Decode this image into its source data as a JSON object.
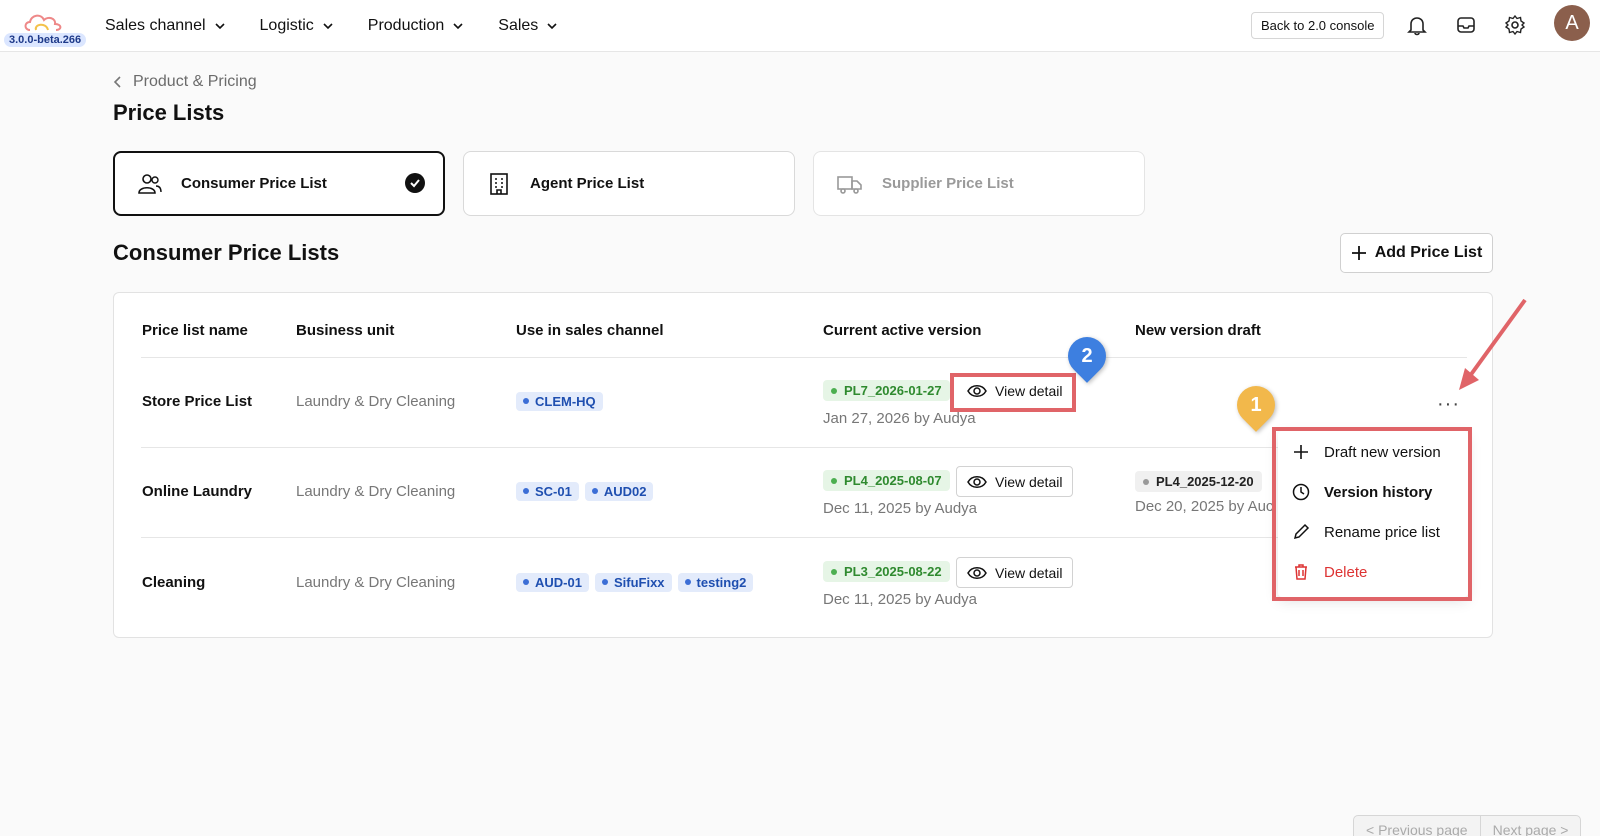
{
  "app": {
    "version": "3.0.0-beta.266"
  },
  "nav": [
    "Sales channel",
    "Logistic",
    "Production",
    "Sales"
  ],
  "header": {
    "back_label": "Back to 2.0 console",
    "avatar_letter": "A"
  },
  "breadcrumb": "Product & Pricing",
  "page_title": "Price Lists",
  "types": [
    {
      "label": "Consumer Price List",
      "state": "active"
    },
    {
      "label": "Agent Price List",
      "state": "default"
    },
    {
      "label": "Supplier Price List",
      "state": "disabled"
    }
  ],
  "section_title": "Consumer Price Lists",
  "add_label": "Add Price List",
  "table": {
    "columns": [
      "Price list name",
      "Business unit",
      "Use in sales channel",
      "Current active version",
      "New version draft"
    ],
    "rows": [
      {
        "name": "Store Price List",
        "unit": "Laundry & Dry Cleaning",
        "channels": [
          "CLEM-HQ"
        ],
        "active_version": "PL7_2026-01-27",
        "active_meta": "Jan 27, 2026 by Audya",
        "draft_version": "",
        "draft_meta": ""
      },
      {
        "name": "Online Laundry",
        "unit": "Laundry & Dry Cleaning",
        "channels": [
          "SC-01",
          "AUD02"
        ],
        "active_version": "PL4_2025-08-07",
        "active_meta": "Dec 11, 2025 by Audya",
        "draft_version": "PL4_2025-12-20",
        "draft_meta": "Dec 20, 2025 by Auc"
      },
      {
        "name": "Cleaning",
        "unit": "Laundry & Dry Cleaning",
        "channels": [
          "AUD-01",
          "SifuFixx",
          "testing2"
        ],
        "active_version": "PL3_2025-08-22",
        "active_meta": "Dec 11, 2025 by Audya",
        "draft_version": "",
        "draft_meta": ""
      }
    ],
    "view_label": "View detail"
  },
  "menu": {
    "draft": "Draft new version",
    "history": "Version history",
    "rename": "Rename price list",
    "delete": "Delete"
  },
  "annotations": {
    "pin1": "1",
    "pin2": "2"
  },
  "pager": {
    "prev": "< Previous page",
    "next": "Next page >"
  },
  "colors": {
    "annotation_red": "#e06468",
    "pin_blue": "#3d7fe0",
    "pin_yellow": "#f2b84b"
  }
}
